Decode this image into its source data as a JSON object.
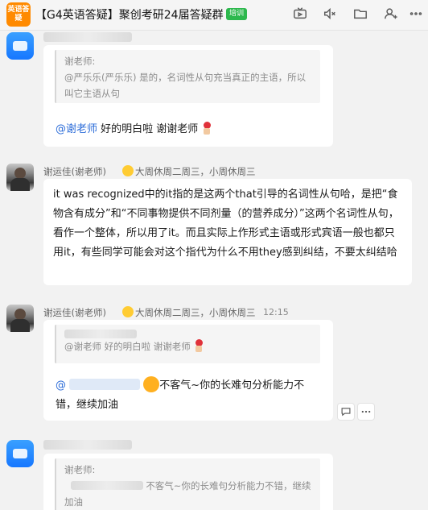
{
  "header": {
    "avatar_text": "英语答疑",
    "title": "【G4英语答疑】聚创考研24届答疑群",
    "badge": "培训",
    "icons": [
      "tv-icon",
      "mute-icon",
      "folder-icon",
      "add-user-icon",
      "more-icon"
    ]
  },
  "messages": [
    {
      "quote_sender": "谢老师:",
      "quote_text": "@严乐乐(严乐乐) 是的，名词性从句充当真正的主语，所以叫它主语从句",
      "mention": "@谢老师",
      "body": "好的明白啦 谢谢老师"
    },
    {
      "sender": "谢运佳(谢老师)",
      "status": "大周休周二周三，小周休周三",
      "body": "it was recognized中的it指的是这两个that引导的名词性从句哈，是把“食物含有成分”和“不同事物提供不同剂量（的营养成分）”这两个名词性从句，看作一个整体，所以用了it。而且实际上作形式主语或形式宾语一般也都只用it，有些同学可能会对这个指代为什么不用they感到纠结，不要太纠结哈"
    },
    {
      "sender": "谢运佳(谢老师)",
      "status": "大周休周二周三，小周休周三",
      "time": "12:15",
      "quote_text": "@谢老师 好的明白啦 谢谢老师",
      "mention": "@",
      "body": "不客气~你的长难句分析能力不错，继续加油"
    },
    {
      "quote_sender": "谢老师:",
      "quote_text": "不客气~你的长难句分析能力不错，继续加油"
    }
  ],
  "colors": {
    "accent_mention": "#2a6bd8",
    "group_avatar": "#ff8a00",
    "badge": "#2db84d"
  }
}
